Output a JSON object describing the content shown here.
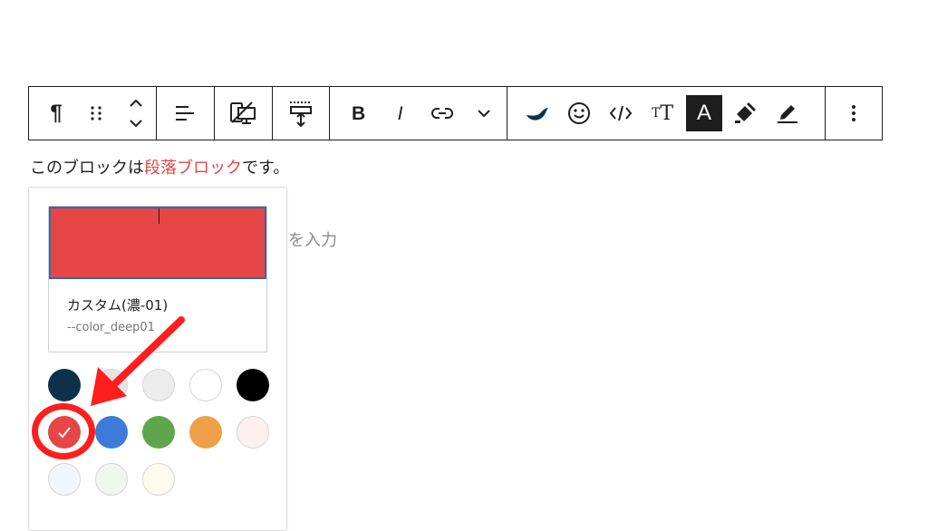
{
  "toolbar": {
    "groups": [
      [
        {
          "name": "paragraph-icon",
          "glyph": "¶"
        },
        {
          "name": "drag-handle-icon"
        },
        {
          "name": "move-up-down-icon"
        }
      ],
      [
        {
          "name": "align-left-icon"
        }
      ],
      [
        {
          "name": "device-visibility-icon"
        }
      ],
      [
        {
          "name": "spacing-icon"
        }
      ],
      [
        {
          "name": "bold-icon",
          "glyph": "B"
        },
        {
          "name": "italic-icon",
          "glyph": "I"
        },
        {
          "name": "link-icon"
        },
        {
          "name": "chevron-down-icon"
        }
      ],
      [
        {
          "name": "brand-wave-icon"
        },
        {
          "name": "emoji-icon"
        },
        {
          "name": "code-icon"
        },
        {
          "name": "font-size-icon",
          "glyph": "TT"
        },
        {
          "name": "text-color-icon",
          "glyph": "A"
        },
        {
          "name": "marker-icon"
        },
        {
          "name": "highlighter-icon"
        }
      ],
      [
        {
          "name": "more-options-icon"
        }
      ]
    ]
  },
  "paragraph": {
    "before": "このブロックは",
    "highlight": "段落ブロック",
    "after": "です。"
  },
  "placeholder_text": "を入力",
  "popover": {
    "selected_color": "#e64646",
    "color_name": "カスタム(濃-01)",
    "color_var": "--color_deep01",
    "palette": [
      {
        "color": "#0d3148",
        "selected": false
      },
      {
        "color": "#e5e5e5",
        "selected": false
      },
      {
        "color": "#ececec",
        "selected": false
      },
      {
        "color": "#ffffff",
        "selected": false
      },
      {
        "color": "#000000",
        "selected": false
      },
      {
        "color": "#e64646",
        "selected": true
      },
      {
        "color": "#3d7bd8",
        "selected": false
      },
      {
        "color": "#5ea54b",
        "selected": false
      },
      {
        "color": "#f0a048",
        "selected": false
      },
      {
        "color": "#fdf0ee",
        "selected": false
      },
      {
        "color": "#f1f6fd",
        "selected": false
      },
      {
        "color": "#f0f7ee",
        "selected": false
      },
      {
        "color": "#fdfaee",
        "selected": false
      }
    ]
  },
  "annotation_color": "#ff1e1e"
}
